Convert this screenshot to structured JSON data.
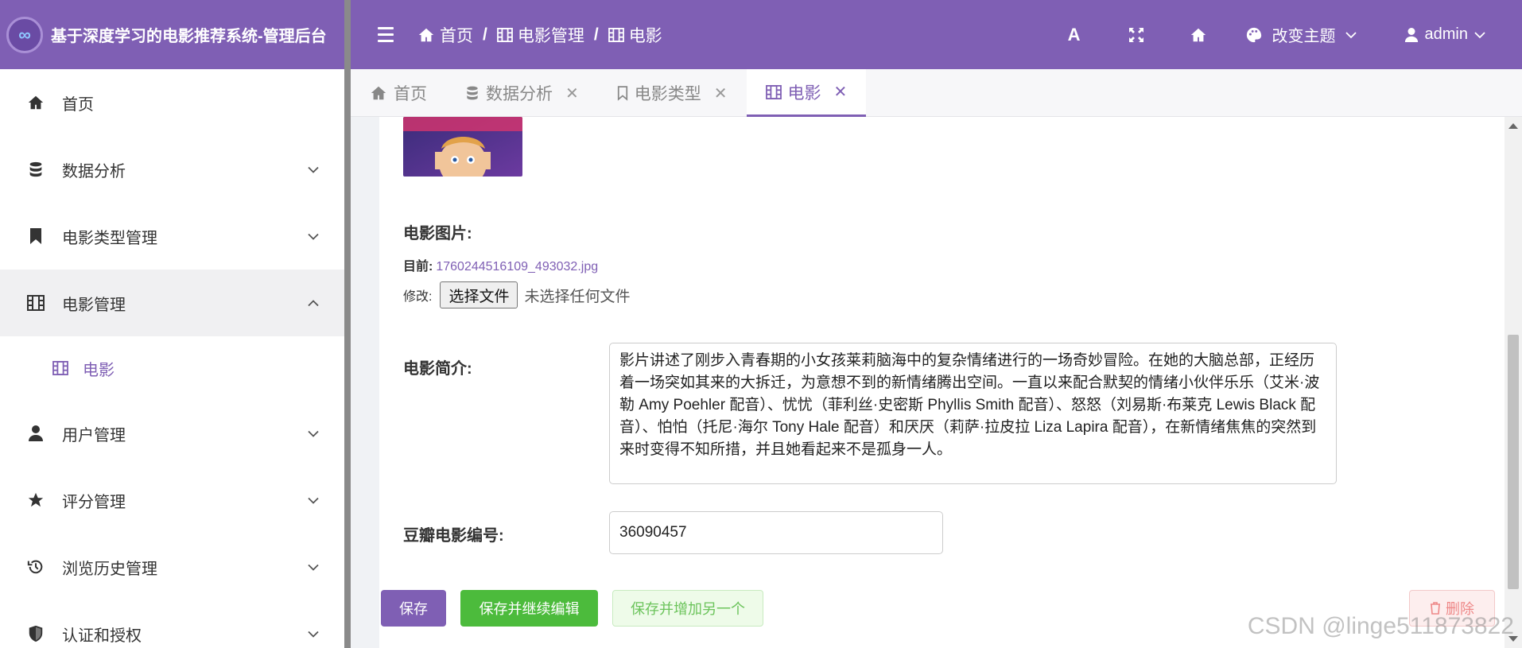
{
  "brand": {
    "title": "基于深度学习的电影推荐系统-管理后台",
    "logo_text": "∞"
  },
  "sidebar": {
    "items": [
      {
        "label": "首页",
        "icon": "home-icon"
      },
      {
        "label": "数据分析",
        "icon": "database-icon"
      },
      {
        "label": "电影类型管理",
        "icon": "bookmark-icon"
      },
      {
        "label": "电影管理",
        "icon": "film-icon"
      },
      {
        "label": "用户管理",
        "icon": "user-icon"
      },
      {
        "label": "评分管理",
        "icon": "star-icon"
      },
      {
        "label": "浏览历史管理",
        "icon": "history-icon"
      },
      {
        "label": "认证和授权",
        "icon": "shield-icon"
      }
    ],
    "subitem": {
      "label": "电影",
      "icon": "film-icon"
    }
  },
  "topbar": {
    "breadcrumb": [
      "首页",
      "电影管理",
      "电影"
    ],
    "font_icon_label": "A",
    "theme_label": "改变主题",
    "user_label": "admin"
  },
  "tabs": [
    {
      "label": "首页",
      "closable": false
    },
    {
      "label": "数据分析",
      "closable": true
    },
    {
      "label": "电影类型",
      "closable": true
    },
    {
      "label": "电影",
      "closable": true,
      "active": true
    }
  ],
  "form": {
    "image_label": "电影图片:",
    "current_prefix": "目前:",
    "current_file": "1760244516109_493032.jpg",
    "modify_prefix": "修改:",
    "choose_file_label": "选择文件",
    "no_file_label": "未选择任何文件",
    "intro_label": "电影简介:",
    "intro_value": "影片讲述了刚步入青春期的小女孩莱莉脑海中的复杂情绪进行的一场奇妙冒险。在她的大脑总部，正经历着一场突如其来的大拆迁，为意想不到的新情绪腾出空间。一直以来配合默契的情绪小伙伴乐乐（艾米·波勒 Amy Poehler 配音）、忧忧（菲利丝·史密斯 Phyllis Smith 配音）、怒怒（刘易斯·布莱克 Lewis Black 配音）、怕怕（托尼·海尔 Tony Hale 配音）和厌厌（莉萨·拉皮拉 Liza Lapira 配音），在新情绪焦焦的突然到来时变得不知所措，并且她看起来不是孤身一人。",
    "douban_label": "豆瓣电影编号:",
    "douban_value": "36090457"
  },
  "actions": {
    "save": "保存",
    "save_continue": "保存并继续编辑",
    "save_add": "保存并增加另一个",
    "delete": "删除"
  },
  "watermark": "CSDN @linge511873822",
  "colors": {
    "primary": "#7f5fb4",
    "success": "#4cbb3c",
    "danger": "#e88888"
  }
}
